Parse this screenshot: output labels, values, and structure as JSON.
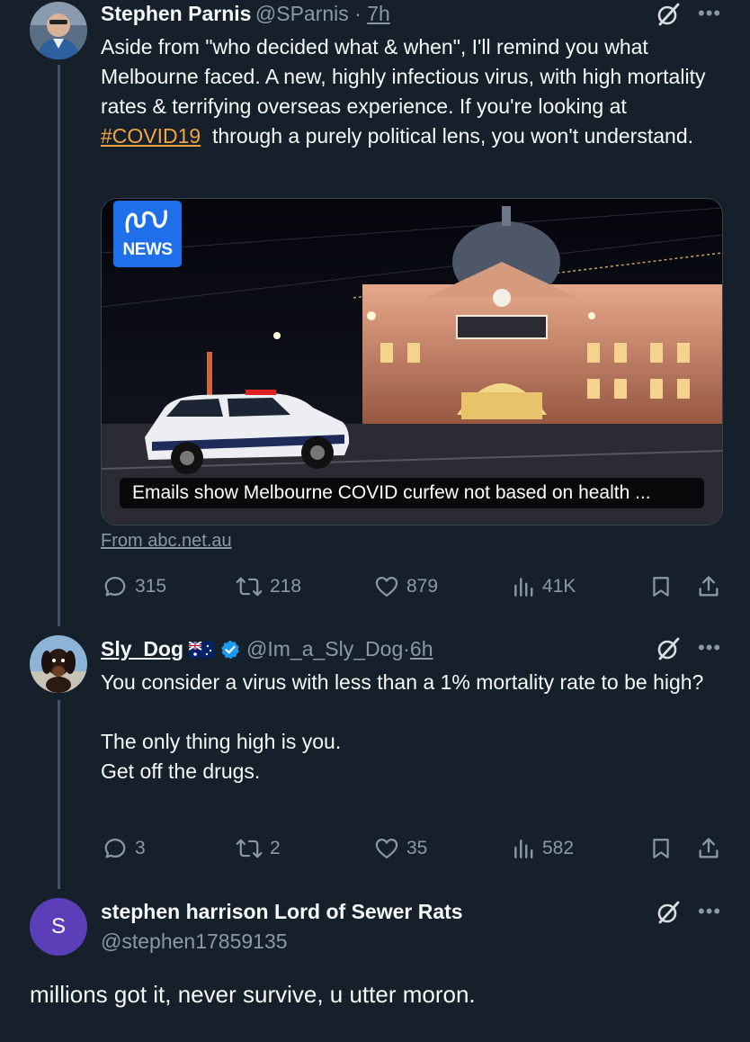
{
  "tweets": [
    {
      "name": "Stephen Parnis",
      "handle": "@SParnis",
      "time": "7h",
      "text_before": "Aside from \"who decided what & when\", I'll remind you what Melbourne faced. A new, highly infectious virus, with high mortality rates & terrifying overseas experience. If you're looking at ",
      "hashtag": "#COVID19",
      "text_after": "  through a purely political lens, you won't understand.",
      "card": {
        "logo_text": "NEWS",
        "caption": "Emails show Melbourne COVID curfew not based on health ...",
        "source": "From abc.net.au"
      },
      "stats": {
        "replies": "315",
        "retweets": "218",
        "likes": "879",
        "views": "41K"
      }
    },
    {
      "name": "Sly_Dog",
      "handle": "@Im_a_Sly_Dog",
      "time": "6h",
      "line1": "You consider a virus with less than a 1% mortality rate to be high?",
      "line2": "The only thing high is you.",
      "line3": "Get off the drugs.",
      "stats": {
        "replies": "3",
        "retweets": "2",
        "likes": "35",
        "views": "582"
      }
    },
    {
      "name": "stephen harrison Lord of Sewer Rats",
      "handle": "@stephen17859135",
      "avatar_letter": "S",
      "text": "millions got it, never survive, u utter moron."
    }
  ],
  "separator": " · ",
  "colors": {
    "background": "#15202b",
    "hashtag": "#f4a341",
    "muted": "#8b98a5",
    "verified": "#1d9bf0",
    "avatar_purple": "#5b3fb8"
  }
}
